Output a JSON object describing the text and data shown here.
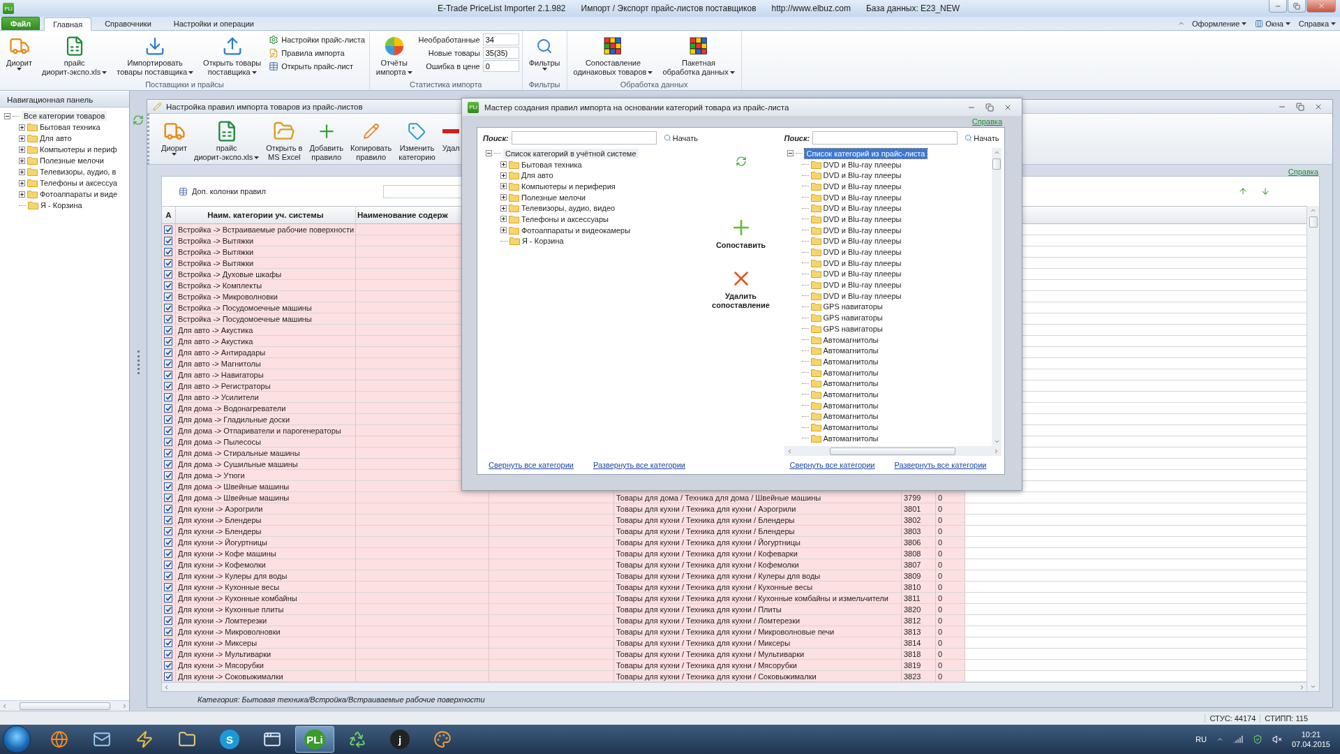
{
  "title_bar": {
    "logo": "PLi",
    "texts": [
      "E-Trade PriceList Importer 2.1.982",
      "Импорт / Экспорт прайс-листов поставщиков",
      "http://www.elbuz.com",
      "База данных: E23_NEW"
    ]
  },
  "ribbon_tabs": [
    {
      "label": "Файл",
      "kind": "file",
      "selected": false
    },
    {
      "label": "Главная",
      "kind": "tab",
      "selected": true
    },
    {
      "label": "Справочники",
      "kind": "tab",
      "selected": false
    },
    {
      "label": "Настройки и операции",
      "kind": "tab",
      "selected": false
    }
  ],
  "ribbon_menus": [
    "Оформление",
    "Окна",
    "Справка"
  ],
  "ribbon_groups": [
    {
      "label": "Поставщики и прайсы",
      "buttons": [
        {
          "lines": [
            "Диорит"
          ],
          "dropdown": true
        },
        {
          "lines": [
            "прайс",
            "диорит-экспо.xls"
          ],
          "dropdown": true
        },
        {
          "lines": [
            "Импортировать",
            "товары поставщика"
          ],
          "dropdown": true
        },
        {
          "lines": [
            "Открыть товары",
            "поставщика"
          ],
          "dropdown": true
        }
      ],
      "small_buttons": [
        "Настройки прайс-листа",
        "Правила импорта",
        "Открыть прайс-лист"
      ]
    },
    {
      "label": "Статистика импорта",
      "buttons": [
        {
          "lines": [
            "Отчёты",
            "импорта"
          ],
          "dropdown": true
        }
      ],
      "stats": [
        {
          "label": "Необработанные",
          "value": "34"
        },
        {
          "label": "Новые товары",
          "value": "35(35)"
        },
        {
          "label": "Ошибка в цене",
          "value": "0"
        }
      ]
    },
    {
      "label": "Фильтры",
      "buttons": [
        {
          "lines": [
            "Фильтры"
          ],
          "dropdown": true
        }
      ]
    },
    {
      "label": "Обработка данных",
      "buttons": [
        {
          "lines": [
            "Сопоставление",
            "одинаковых товаров"
          ],
          "dropdown": true
        },
        {
          "lines": [
            "Пакетная",
            "обработка данных"
          ],
          "dropdown": true
        }
      ]
    }
  ],
  "navigation_panel": {
    "title": "Навигационная панель",
    "tree": {
      "label": "Все категории товаров",
      "expanded": true,
      "selected": false,
      "children": [
        {
          "label": "Бытовая техника",
          "expandable": true
        },
        {
          "label": "Для авто",
          "expandable": true
        },
        {
          "label": "Компьютеры и периф",
          "expandable": true
        },
        {
          "label": "Полезные мелочи",
          "expandable": true
        },
        {
          "label": "Телевизоры, аудио, в",
          "expandable": true
        },
        {
          "label": "Телефоны и аксессуа",
          "expandable": true
        },
        {
          "label": "Фотоаппараты и виде",
          "expandable": true
        },
        {
          "label": "Я - Корзина",
          "expandable": false
        }
      ]
    }
  },
  "rules_window": {
    "title": "Настройка правил импорта товаров из прайс-листов",
    "toolbar": [
      {
        "lines": [
          "Диорит"
        ],
        "dropdown": true
      },
      {
        "lines": [
          "прайс",
          "диорит-экспо.xls"
        ],
        "dropdown": true
      },
      {
        "lines": [
          "Открыть в",
          "MS Excel"
        ],
        "dropdown": false
      },
      {
        "lines": [
          "Добавить",
          "правило"
        ],
        "dropdown": false
      },
      {
        "lines": [
          "Копировать",
          "правило"
        ],
        "dropdown": false
      },
      {
        "lines": [
          "Изменить",
          "категорию"
        ],
        "dropdown": false
      },
      {
        "lines": [
          "Удал"
        ],
        "dropdown": false
      }
    ],
    "help_link": "Справка",
    "extra_columns_button": "Доп. колонки правил",
    "category_path": "Категория: Бытовая техника/Встройка/Встраиваемые рабочие поверхности"
  },
  "table": {
    "columns": [
      "А",
      "Наим. категории уч. системы",
      "Наименование содерж"
    ],
    "rows": [
      {
        "checked": true,
        "category": "Встройка -> Встраиваемые рабочие поверхности"
      },
      {
        "checked": true,
        "category": "Встройка -> Вытяжки"
      },
      {
        "checked": true,
        "category": "Встройка -> Вытяжки"
      },
      {
        "checked": true,
        "category": "Встройка -> Вытяжки"
      },
      {
        "checked": true,
        "category": "Встройка -> Духовые шкафы"
      },
      {
        "checked": true,
        "category": "Встройка -> Комплекты"
      },
      {
        "checked": true,
        "category": "Встройка -> Микроволновки"
      },
      {
        "checked": true,
        "category": "Встройка -> Посудомоечные машины"
      },
      {
        "checked": true,
        "category": "Встройка -> Посудомоечные машины"
      },
      {
        "checked": true,
        "category": "Для авто -> Акустика"
      },
      {
        "checked": true,
        "category": "Для авто -> Акустика"
      },
      {
        "checked": true,
        "category": "Для авто -> Антирадары"
      },
      {
        "checked": true,
        "category": "Для авто -> Магнитолы"
      },
      {
        "checked": true,
        "category": "Для авто -> Навигаторы"
      },
      {
        "checked": true,
        "category": "Для авто -> Регистраторы"
      },
      {
        "checked": true,
        "category": "Для авто -> Усилители"
      },
      {
        "checked": true,
        "category": "Для дома -> Водонагреватели"
      },
      {
        "checked": true,
        "category": "Для дома -> Гладильные доски"
      },
      {
        "checked": true,
        "category": "Для дома -> Отпариватели и парогенераторы"
      },
      {
        "checked": true,
        "category": "Для дома -> Пылесосы"
      },
      {
        "checked": true,
        "category": "Для дома -> Стиральные машины"
      },
      {
        "checked": true,
        "category": "Для дома -> Сушильные машины"
      },
      {
        "checked": true,
        "category": "Для дома -> Утюги"
      },
      {
        "checked": true,
        "category": "Для дома -> Швейные машины"
      },
      {
        "checked": true,
        "category": "Для дома -> Швейные машины",
        "price_category": "Товары для дома / Техника для дома / Швейные машины",
        "code": "3799",
        "count": "0"
      },
      {
        "checked": true,
        "category": "Для кухни -> Аэрогрили",
        "price_category": "Товары для кухни / Техника для кухни / Аэрогрили",
        "code": "3801",
        "count": "0"
      },
      {
        "checked": true,
        "category": "Для кухни -> Блендеры",
        "price_category": "Товары для кухни / Техника для кухни / Блендеры",
        "code": "3802",
        "count": "0"
      },
      {
        "checked": true,
        "category": "Для кухни -> Блендеры",
        "price_category": "Товары для кухни / Техника для кухни / Блендеры",
        "code": "3803",
        "count": "0"
      },
      {
        "checked": true,
        "category": "Для кухни -> Йогуртницы",
        "price_category": "Товары для кухни / Техника для кухни / Йогуртницы",
        "code": "3806",
        "count": "0"
      },
      {
        "checked": true,
        "category": "Для кухни -> Кофе машины",
        "price_category": "Товары для кухни / Техника для кухни / Кофеварки",
        "code": "3808",
        "count": "0"
      },
      {
        "checked": true,
        "category": "Для кухни -> Кофемолки",
        "price_category": "Товары для кухни / Техника для кухни / Кофемолки",
        "code": "3807",
        "count": "0"
      },
      {
        "checked": true,
        "category": "Для кухни -> Кулеры для воды",
        "price_category": "Товары для кухни / Техника для кухни / Кулеры для воды",
        "code": "3809",
        "count": "0"
      },
      {
        "checked": true,
        "category": "Для кухни -> Кухонные весы",
        "price_category": "Товары для кухни / Техника для кухни / Кухонные весы",
        "code": "3810",
        "count": "0"
      },
      {
        "checked": true,
        "category": "Для кухни -> Кухонные комбайны",
        "price_category": "Товары для кухни / Техника для кухни / Кухонные комбайны и измельчители",
        "code": "3811",
        "count": "0"
      },
      {
        "checked": true,
        "category": "Для кухни -> Кухонные плиты",
        "price_category": "Товары для кухни / Техника для кухни / Плиты",
        "code": "3820",
        "count": "0"
      },
      {
        "checked": true,
        "category": "Для кухни -> Ломтерезки",
        "price_category": "Товары для кухни / Техника для кухни / Ломтерезки",
        "code": "3812",
        "count": "0"
      },
      {
        "checked": true,
        "category": "Для кухни -> Микроволновки",
        "price_category": "Товары для кухни / Техника для кухни / Микроволновые печи",
        "code": "3813",
        "count": "0"
      },
      {
        "checked": true,
        "category": "Для кухни -> Миксеры",
        "price_category": "Товары для кухни / Техника для кухни / Миксеры",
        "code": "3814",
        "count": "0"
      },
      {
        "checked": true,
        "category": "Для кухни -> Мультиварки",
        "price_category": "Товары для кухни / Техника для кухни / Мультиварки",
        "code": "3818",
        "count": "0"
      },
      {
        "checked": true,
        "category": "Для кухни -> Мясорубки",
        "price_category": "Товары для кухни / Техника для кухни / Мясорубки",
        "code": "3819",
        "count": "0"
      },
      {
        "checked": true,
        "category": "Для кухни -> Соковыжималки",
        "price_category": "Товары для кухни / Техника для кухни / Соковыжималки",
        "code": "3823",
        "count": "0"
      }
    ]
  },
  "dialog": {
    "logo": "PLi",
    "title": "Мастер создания правил импорта на основании категорий товара из прайс-листа",
    "help_link": "Справка",
    "left": {
      "search_label": "Поиск:",
      "search_button": "Начать",
      "collapse_link": "Свернуть все категории",
      "expand_link": "Развернуть все категории",
      "tree": {
        "label": "Список категорий в учётной системе",
        "expanded": true,
        "selected": false,
        "children": [
          {
            "label": "Бытовая техника",
            "expandable": true
          },
          {
            "label": "Для авто",
            "expandable": true
          },
          {
            "label": "Компьютеры и периферия",
            "expandable": true
          },
          {
            "label": "Полезные мелочи",
            "expandable": true
          },
          {
            "label": "Телевизоры, аудио, видео",
            "expandable": true
          },
          {
            "label": "Телефоны и аксессуары",
            "expandable": true
          },
          {
            "label": "Фотоаппараты и видеокамеры",
            "expandable": true
          },
          {
            "label": "Я - Корзина",
            "expandable": false
          }
        ]
      }
    },
    "actions": [
      {
        "label": "Сопоставить",
        "kind": "add"
      },
      {
        "label": "Удалить сопоставление",
        "kind": "delete"
      }
    ],
    "right": {
      "search_label": "Поиск:",
      "search_button": "Начать",
      "collapse_link": "Свернуть все категории",
      "expand_link": "Развернуть все категории",
      "tree": {
        "label": "Список категорий из прайс-листа",
        "expanded": true,
        "selected": true,
        "children": [
          {
            "label": "DVD и Blu-ray плееры",
            "expandable": false
          },
          {
            "label": "DVD и Blu-ray плееры",
            "expandable": false
          },
          {
            "label": "DVD и Blu-ray плееры",
            "expandable": false
          },
          {
            "label": "DVD и Blu-ray плееры",
            "expandable": false
          },
          {
            "label": "DVD и Blu-ray плееры",
            "expandable": false
          },
          {
            "label": "DVD и Blu-ray плееры",
            "expandable": false
          },
          {
            "label": "DVD и Blu-ray плееры",
            "expandable": false
          },
          {
            "label": "DVD и Blu-ray плееры",
            "expandable": false
          },
          {
            "label": "DVD и Blu-ray плееры",
            "expandable": false
          },
          {
            "label": "DVD и Blu-ray плееры",
            "expandable": false
          },
          {
            "label": "DVD и Blu-ray плееры",
            "expandable": false
          },
          {
            "label": "DVD и Blu-ray плееры",
            "expandable": false
          },
          {
            "label": "DVD и Blu-ray плееры",
            "expandable": false
          },
          {
            "label": "GPS навигаторы",
            "expandable": false
          },
          {
            "label": "GPS навигаторы",
            "expandable": false
          },
          {
            "label": "GPS навигаторы",
            "expandable": false
          },
          {
            "label": "Автомагнитолы",
            "expandable": false
          },
          {
            "label": "Автомагнитолы",
            "expandable": false
          },
          {
            "label": "Автомагнитолы",
            "expandable": false
          },
          {
            "label": "Автомагнитолы",
            "expandable": false
          },
          {
            "label": "Автомагнитолы",
            "expandable": false
          },
          {
            "label": "Автомагнитолы",
            "expandable": false
          },
          {
            "label": "Автомагнитолы",
            "expandable": false
          },
          {
            "label": "Автомагнитолы",
            "expandable": false
          },
          {
            "label": "Автомагнитолы",
            "expandable": false
          },
          {
            "label": "Автомагнитолы",
            "expandable": false
          }
        ]
      }
    }
  },
  "status_bar": [
    "СТУС: 44174",
    "СТИПП: 115"
  ],
  "taskbar": {
    "apps": [
      {
        "selected": false
      },
      {
        "selected": false
      },
      {
        "selected": false
      },
      {
        "selected": false
      },
      {
        "glyph": "S",
        "selected": false
      },
      {
        "selected": false
      },
      {
        "glyph": "PLi",
        "selected": true
      },
      {
        "selected": false
      },
      {
        "glyph": "j",
        "selected": false
      },
      {
        "selected": false
      }
    ],
    "language": "RU",
    "time": "10:21",
    "date": "07.04.2015"
  }
}
